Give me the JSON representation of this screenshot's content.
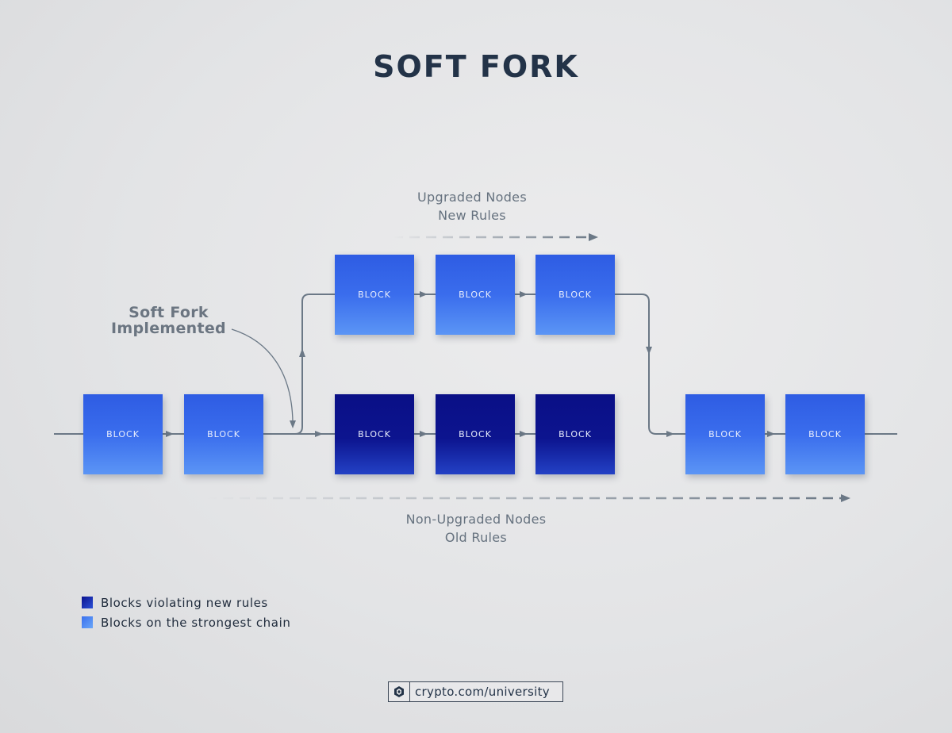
{
  "title": "SOFT FORK",
  "labels": {
    "upgraded_line1": "Upgraded Nodes",
    "upgraded_line2": "New Rules",
    "nonupgraded_line1": "Non-Upgraded Nodes",
    "nonupgraded_line2": "Old Rules",
    "fork_line1": "Soft Fork",
    "fork_line2": "Implemented"
  },
  "blocks": {
    "main_before_fork": [
      {
        "label": "BLOCK",
        "type": "strongest-chain"
      },
      {
        "label": "BLOCK",
        "type": "strongest-chain"
      }
    ],
    "upgraded_branch": [
      {
        "label": "BLOCK",
        "type": "strongest-chain"
      },
      {
        "label": "BLOCK",
        "type": "strongest-chain"
      },
      {
        "label": "BLOCK",
        "type": "strongest-chain"
      }
    ],
    "old_rules_branch": [
      {
        "label": "BLOCK",
        "type": "violating-new-rules"
      },
      {
        "label": "BLOCK",
        "type": "violating-new-rules"
      },
      {
        "label": "BLOCK",
        "type": "violating-new-rules"
      }
    ],
    "main_after_merge": [
      {
        "label": "BLOCK",
        "type": "strongest-chain"
      },
      {
        "label": "BLOCK",
        "type": "strongest-chain"
      }
    ]
  },
  "legend": [
    {
      "label": "Blocks violating new rules",
      "type": "violating-new-rules"
    },
    {
      "label": "Blocks on the strongest chain",
      "type": "strongest-chain"
    }
  ],
  "colors": {
    "strongest_chain": "#3a6ded",
    "violating_new_rules": "#0c148f",
    "title": "#233348",
    "line": "#6b7886"
  },
  "footer": {
    "icon": "crypto-com-logo-icon",
    "text": "crypto.com/university"
  }
}
